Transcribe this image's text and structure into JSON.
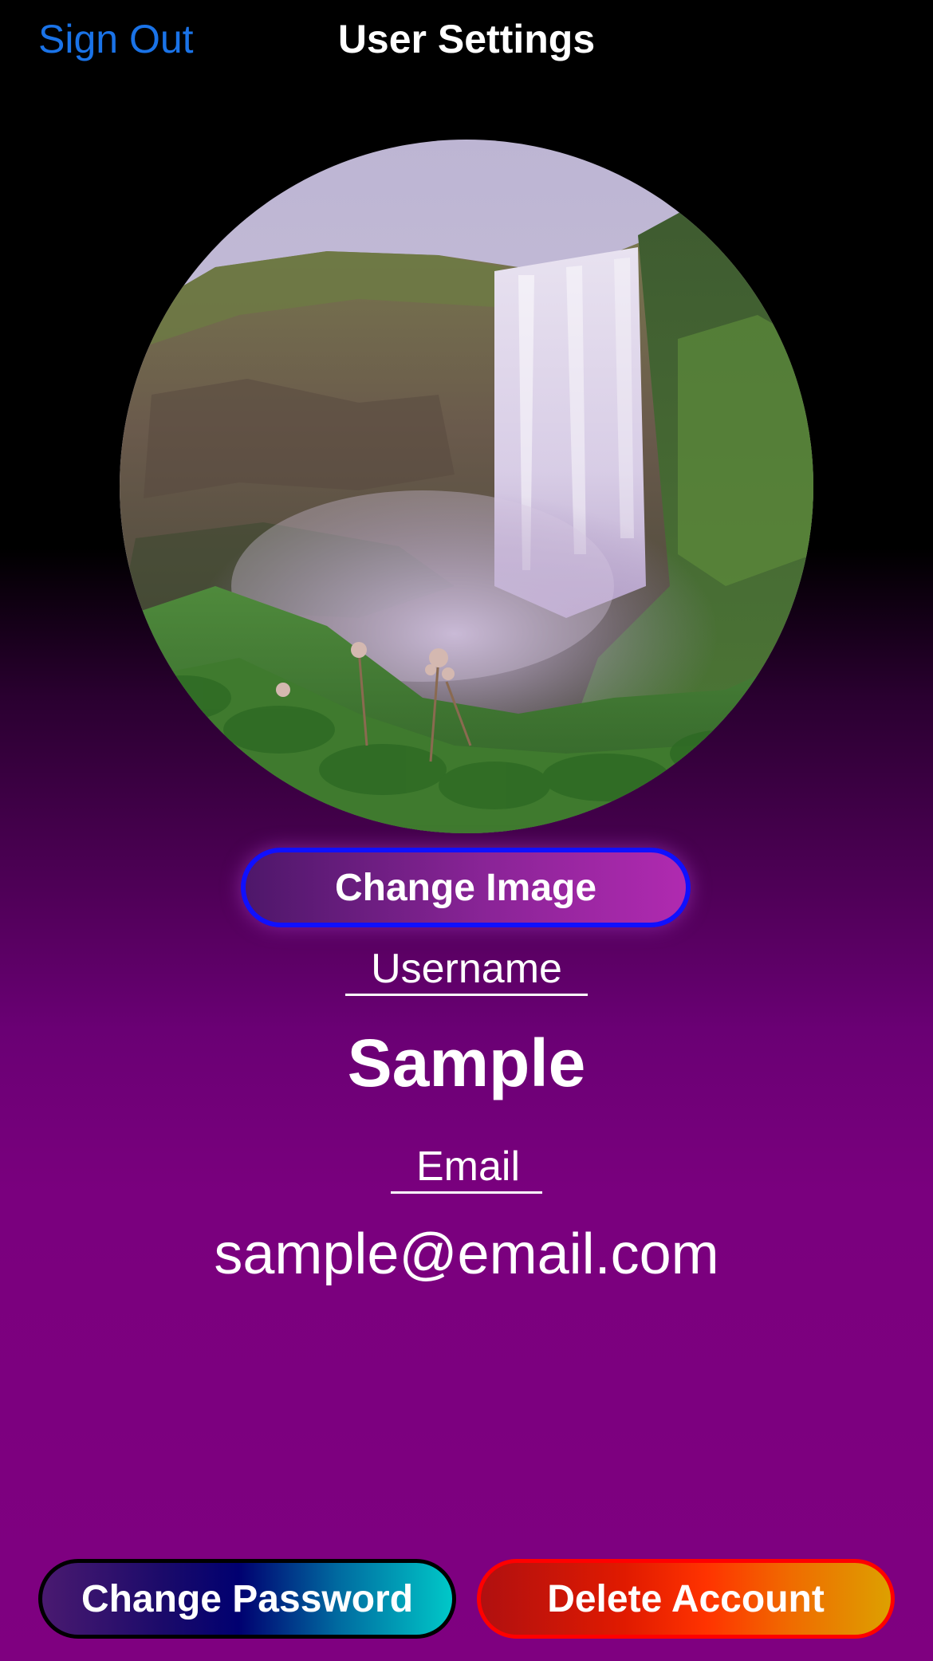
{
  "nav": {
    "sign_out_label": "Sign Out",
    "title": "User Settings"
  },
  "avatar": {
    "icon": "waterfall-photo"
  },
  "change_image_label": "Change Image",
  "profile": {
    "username_label": "Username",
    "username_value": "Sample",
    "email_label": "Email",
    "email_value": "sample@email.com"
  },
  "actions": {
    "change_password_label": "Change Password",
    "delete_account_label": "Delete Account"
  },
  "colors": {
    "link_blue": "#1a73e8",
    "background_top": "#000000",
    "background_bottom": "#7f0080",
    "change_image_border": "#1010ff",
    "delete_border": "#ff0000"
  }
}
